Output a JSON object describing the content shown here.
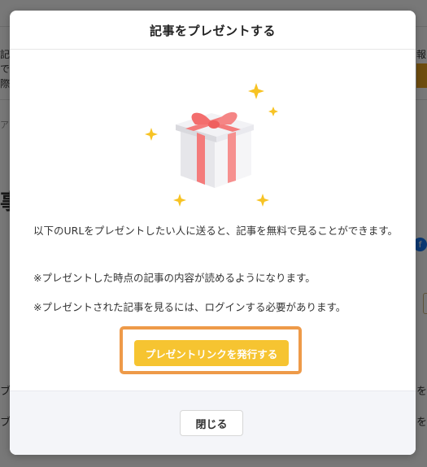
{
  "modal": {
    "title": "記事をプレゼントする",
    "description_1": "以下のURLをプレゼントしたい人に送ると、記事を無料で見ることができます。",
    "description_2": "※プレゼントした時点の記事の内容が読めるようになります。",
    "description_3": "※プレゼントされた記事を見るには、ログインする必要があります。",
    "issue_link_button": "プレゼントリンクを発行する",
    "close_button": "閉じる"
  },
  "background": {
    "fragments": [
      "記",
      "で",
      "際",
      "ア",
      "事",
      "ブ",
      "ブ",
      "報",
      "を",
      "を",
      "f"
    ]
  },
  "colors": {
    "issue_button": "#f6c431",
    "highlight_frame": "#ee9a49",
    "gift_box": "#f0f0f3",
    "ribbon": "#f47b7b",
    "sparkle": "#f7c324",
    "overlay": "rgba(0,0,0,0.53)"
  },
  "icons": {
    "illustration": "gift-box-with-sparkles"
  }
}
